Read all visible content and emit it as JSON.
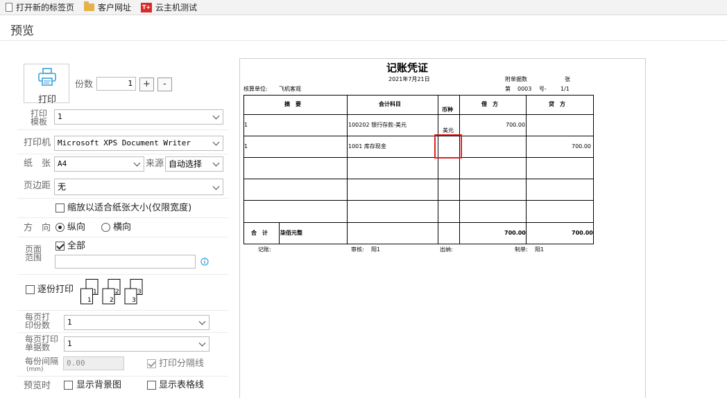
{
  "bookmarks": [
    {
      "label": "打开新的标签页",
      "icon": "page-icon"
    },
    {
      "label": "客户网址",
      "icon": "folder-icon"
    },
    {
      "label": "云主机测试",
      "icon": "brand-logo-icon",
      "logo_text": "T+"
    }
  ],
  "dialog": {
    "title": "预览"
  },
  "print": {
    "button_label": "打印",
    "copies_label": "份数",
    "copies_value": "1",
    "plus": "+",
    "minus": "-"
  },
  "template": {
    "label": "打印模板",
    "value": "1"
  },
  "printer": {
    "label": "打印机",
    "value": "Microsoft XPS Document Writer"
  },
  "paper": {
    "label": "纸　张",
    "value": "A4",
    "source_label": "来源",
    "source_value": "自动选择"
  },
  "margin": {
    "label": "页边距",
    "value": "无"
  },
  "fit_page": {
    "label": "缩放以适合纸张大小(仅限宽度)",
    "checked": false
  },
  "orientation": {
    "label": "方　向",
    "portrait": "纵向",
    "landscape": "横向",
    "selected": "纵向"
  },
  "page_range": {
    "label": "页面范围",
    "all_label": "全部",
    "all_checked": true,
    "value": ""
  },
  "collate": {
    "label": "逐份打印",
    "checked": false,
    "pages": [
      "1",
      "2",
      "3"
    ]
  },
  "copies_per_page": {
    "label": "每页打印份数",
    "value": "1"
  },
  "docs_per_page": {
    "label": "每页打印单据数",
    "value": "1"
  },
  "gap": {
    "label": "每份间隔",
    "unit": "(mm)",
    "value": "0.00"
  },
  "separator": {
    "label": "打印分隔线",
    "checked": true
  },
  "preview": {
    "label": "预览时",
    "show_background": "显示背景图",
    "show_grid": "显示表格线"
  },
  "voucher": {
    "title": "记账凭证",
    "date": "2021年7月21日",
    "attachments_label": "附单据数",
    "attachments_unit": "张",
    "unit_label": "核算单位:",
    "unit_value": "飞机客观",
    "number_prefix": "第",
    "number": "0003",
    "number_suffix": "号-",
    "page": "1/1",
    "headers": {
      "summary": "摘　要",
      "account": "会计科目",
      "currency": "币种",
      "debit": "借　方",
      "credit": "贷　方"
    },
    "rows": [
      {
        "summary": "1",
        "account": "100202 银行存款-美元",
        "currency": "美元",
        "debit": "700.00",
        "credit": ""
      },
      {
        "summary": "1",
        "account": "1001 库存现金",
        "currency": "",
        "debit": "",
        "credit": "700.00"
      }
    ],
    "total_label": "合　计",
    "total_words": "柒佰元整",
    "total_debit": "700.00",
    "total_credit": "700.00",
    "footer": {
      "posted_label": "记账:",
      "reviewer_label": "审核:",
      "reviewer": "阳1",
      "cashier_label": "出纳:",
      "preparer_label": "制单:",
      "preparer": "阳1"
    }
  },
  "colors": {
    "accent_icon": "#3aa0d8",
    "highlight": "#e02020"
  }
}
